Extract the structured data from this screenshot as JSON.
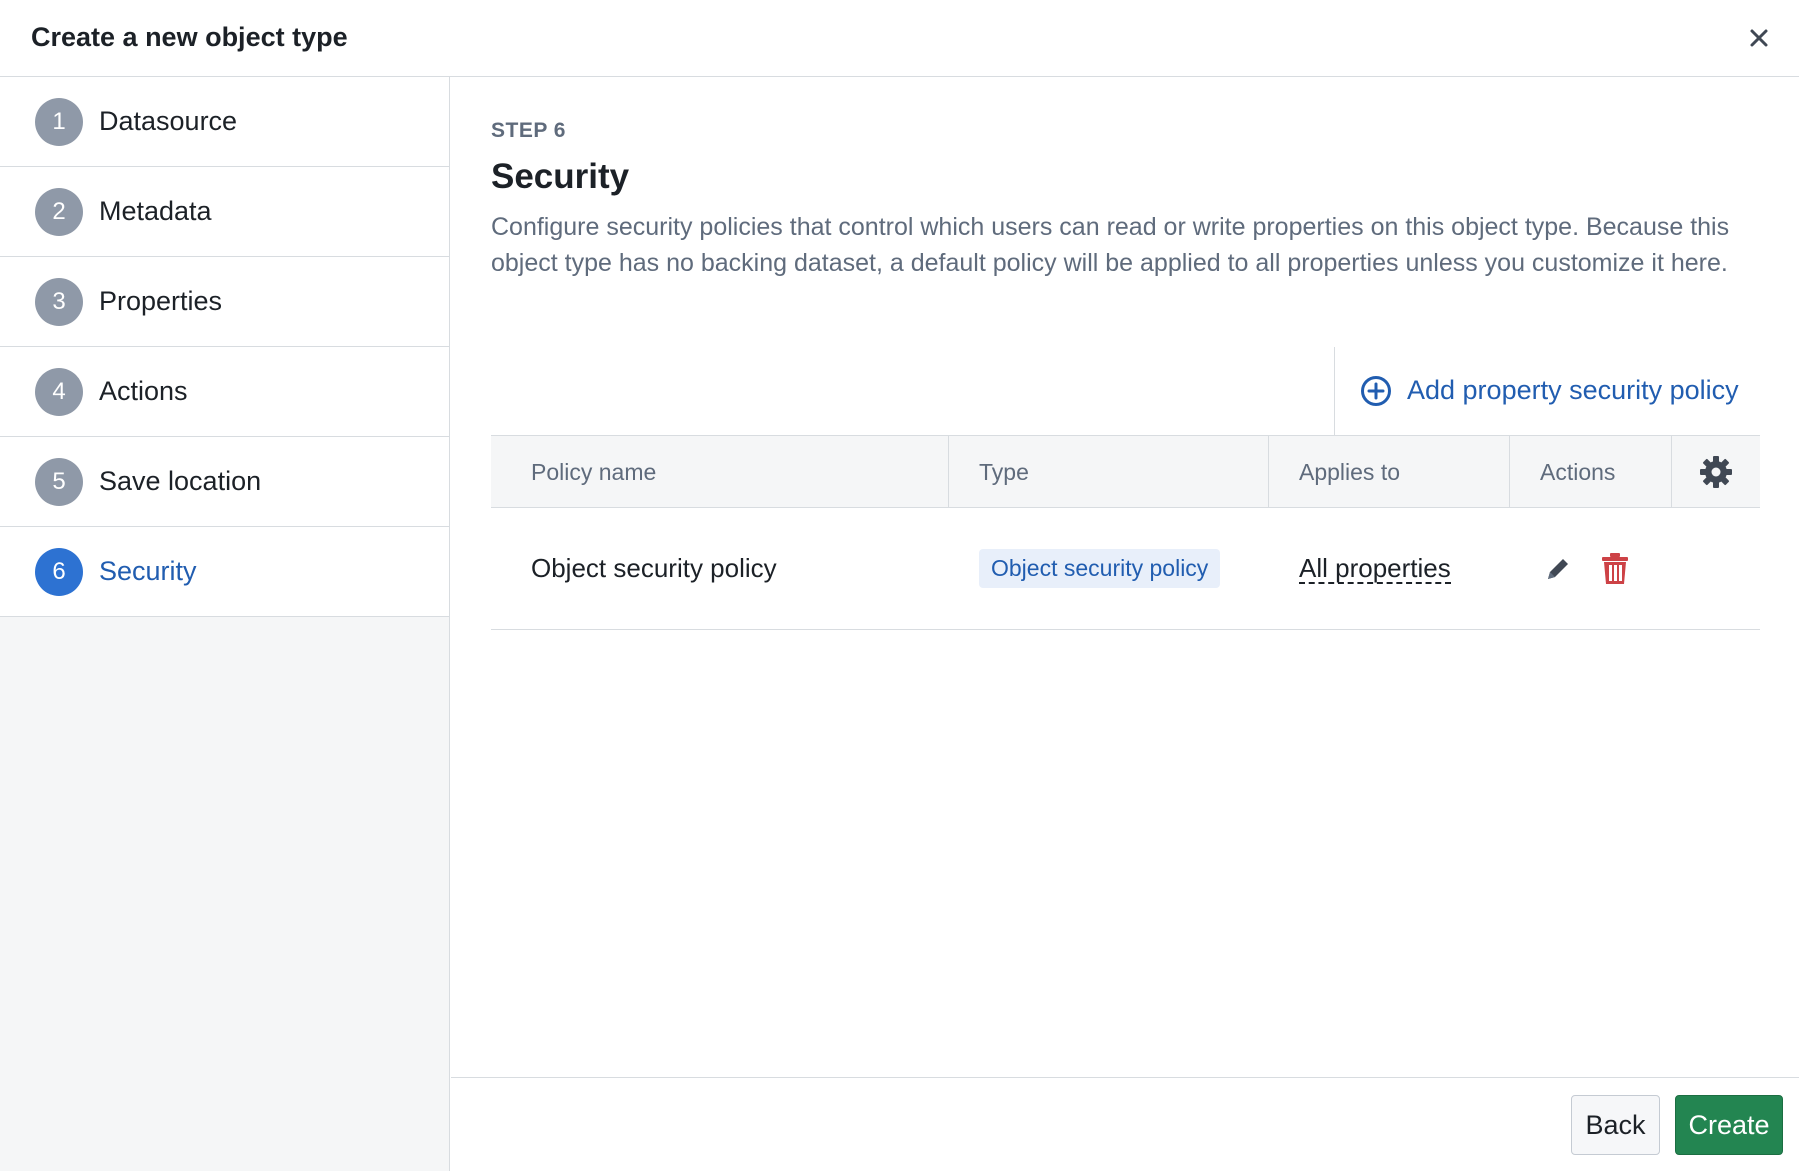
{
  "dialog": {
    "title": "Create a new object type"
  },
  "sidebar": {
    "steps": [
      {
        "num": "1",
        "label": "Datasource"
      },
      {
        "num": "2",
        "label": "Metadata"
      },
      {
        "num": "3",
        "label": "Properties"
      },
      {
        "num": "4",
        "label": "Actions"
      },
      {
        "num": "5",
        "label": "Save location"
      },
      {
        "num": "6",
        "label": "Security"
      }
    ],
    "active_step": "6"
  },
  "main": {
    "kicker": "STEP 6",
    "title": "Security",
    "description": "Configure security policies that control which users can read or write properties on this object type. Because this object type has no backing dataset, a default policy will be applied to all properties unless you customize it here.",
    "add_policy_label": "Add property security policy"
  },
  "table": {
    "columns": [
      "Policy name",
      "Type",
      "Applies to",
      "Actions"
    ],
    "rows": [
      {
        "policy_name": "Object security policy",
        "type": "Object security policy",
        "applies_to": "All properties"
      }
    ]
  },
  "footer": {
    "back_label": "Back",
    "create_label": "Create"
  },
  "colors": {
    "accent": "#2d72d2",
    "link": "#215db0",
    "create": "#238551",
    "delete": "#cd4246"
  },
  "icons": {
    "close": "close-icon",
    "add": "plus-circle-icon",
    "settings": "gear-icon",
    "edit": "pencil-icon",
    "delete": "trash-icon"
  }
}
